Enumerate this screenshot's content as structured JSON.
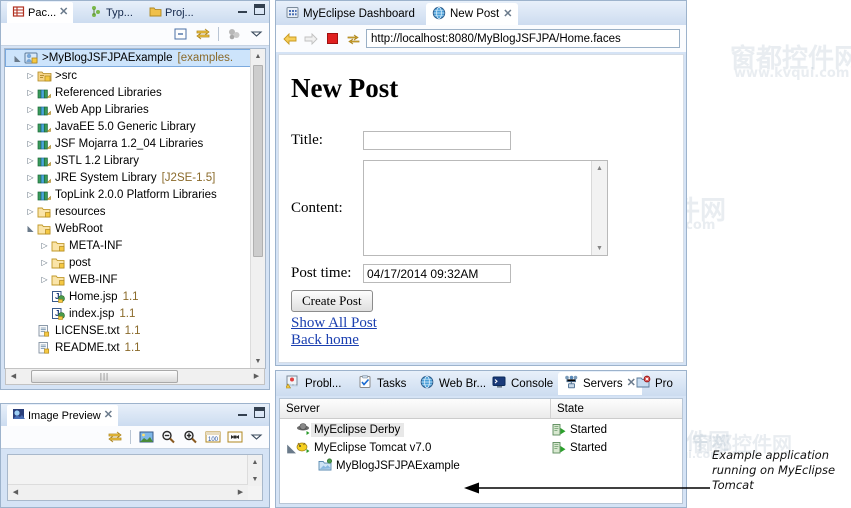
{
  "package_explorer": {
    "tabs": [
      {
        "label": "Pac...",
        "icon": "package-explorer-icon",
        "active": true,
        "closable": true
      },
      {
        "label": "Typ...",
        "icon": "type-hierarchy-icon",
        "active": false,
        "closable": false
      },
      {
        "label": "Proj...",
        "icon": "project-explorer-icon",
        "active": false,
        "closable": false
      }
    ],
    "window_buttons": [
      "minimize",
      "maximize"
    ],
    "toolbar": [
      "collapse-all-icon",
      "link-with-editor-icon",
      "focus-icon",
      "view-menu-icon"
    ],
    "tree": [
      {
        "label": ">MyBlogJSFJPAExample",
        "suffix": "[examples.",
        "icon": "java-project-icon",
        "indent": 0,
        "twisty": "down",
        "selected": true
      },
      {
        "label": ">src",
        "suffix": "",
        "icon": "source-folder-icon",
        "indent": 1,
        "twisty": "right",
        "selected": false
      },
      {
        "label": "Referenced Libraries",
        "suffix": "",
        "icon": "library-icon",
        "indent": 1,
        "twisty": "right",
        "selected": false
      },
      {
        "label": "Web App Libraries",
        "suffix": "",
        "icon": "library-icon",
        "indent": 1,
        "twisty": "right",
        "selected": false
      },
      {
        "label": "JavaEE 5.0 Generic Library",
        "suffix": "",
        "icon": "library-icon",
        "indent": 1,
        "twisty": "right",
        "selected": false
      },
      {
        "label": "JSF Mojarra 1.2_04 Libraries",
        "suffix": "",
        "icon": "library-icon",
        "indent": 1,
        "twisty": "right",
        "selected": false
      },
      {
        "label": "JSTL 1.2 Library",
        "suffix": "",
        "icon": "library-icon",
        "indent": 1,
        "twisty": "right",
        "selected": false
      },
      {
        "label": "JRE System Library",
        "suffix": "[J2SE-1.5]",
        "icon": "library-icon",
        "indent": 1,
        "twisty": "right",
        "selected": false
      },
      {
        "label": "TopLink 2.0.0 Platform Libraries",
        "suffix": "",
        "icon": "library-icon",
        "indent": 1,
        "twisty": "right",
        "selected": false
      },
      {
        "label": "resources",
        "suffix": "",
        "icon": "folder-icon",
        "indent": 1,
        "twisty": "right",
        "selected": false
      },
      {
        "label": "WebRoot",
        "suffix": "",
        "icon": "folder-icon",
        "indent": 1,
        "twisty": "down",
        "selected": false
      },
      {
        "label": "META-INF",
        "suffix": "",
        "icon": "folder-icon",
        "indent": 2,
        "twisty": "right",
        "selected": false
      },
      {
        "label": "post",
        "suffix": "",
        "icon": "folder-icon",
        "indent": 2,
        "twisty": "right",
        "selected": false
      },
      {
        "label": "WEB-INF",
        "suffix": "",
        "icon": "folder-icon",
        "indent": 2,
        "twisty": "right",
        "selected": false
      },
      {
        "label": "Home.jsp",
        "suffix": "1.1",
        "icon": "jsp-file-icon",
        "indent": 2,
        "twisty": "",
        "selected": false
      },
      {
        "label": "index.jsp",
        "suffix": "1.1",
        "icon": "jsp-file-icon",
        "indent": 2,
        "twisty": "",
        "selected": false
      },
      {
        "label": "LICENSE.txt",
        "suffix": "1.1",
        "icon": "text-file-icon",
        "indent": 1,
        "twisty": "",
        "selected": false
      },
      {
        "label": "README.txt",
        "suffix": "1.1",
        "icon": "text-file-icon",
        "indent": 1,
        "twisty": "",
        "selected": false
      }
    ]
  },
  "image_preview": {
    "tab_label": "Image Preview",
    "tab_icon": "image-preview-icon",
    "window_buttons": [
      "minimize",
      "maximize"
    ],
    "toolbar": [
      "link-with-editor-icon",
      "image-icon",
      "zoom-out-icon",
      "zoom-in-icon",
      "zoom-100-icon",
      "fit-image-icon",
      "view-menu-icon"
    ]
  },
  "browser": {
    "tabs": [
      {
        "label": "MyEclipse Dashboard",
        "icon": "dashboard-icon",
        "active": false,
        "closable": false
      },
      {
        "label": "New Post",
        "icon": "globe-icon",
        "active": true,
        "closable": true
      }
    ],
    "nav": {
      "back_icon": "back-arrow-icon",
      "forward_icon": "forward-arrow-icon",
      "stop_icon": "stop-icon",
      "refresh_icon": "refresh-icon"
    },
    "url": "http://localhost:8080/MyBlogJSFJPA/Home.faces"
  },
  "page": {
    "heading": "New Post",
    "fields": [
      {
        "label": "Title:",
        "value": "",
        "type": "text"
      },
      {
        "label": "Content:",
        "value": "",
        "type": "textarea"
      },
      {
        "label": "Post time:",
        "value": "04/17/2014 09:32AM",
        "type": "text"
      }
    ],
    "submit_button": "Create Post",
    "links": [
      "Show All Post",
      "Back home"
    ]
  },
  "bottom_panel": {
    "tabs": [
      {
        "label": "Probl...",
        "icon": "problems-icon",
        "active": false,
        "closable": false
      },
      {
        "label": "Tasks",
        "icon": "tasks-icon",
        "active": false,
        "closable": false
      },
      {
        "label": "Web Br...",
        "icon": "web-browser-icon",
        "active": false,
        "closable": false
      },
      {
        "label": "Console",
        "icon": "console-icon",
        "active": false,
        "closable": false
      },
      {
        "label": "Servers",
        "icon": "servers-icon",
        "active": true,
        "closable": true
      },
      {
        "label": "Pro",
        "icon": "progress-icon",
        "active": false,
        "closable": false
      }
    ],
    "columns": [
      "Server",
      "State"
    ],
    "rows": [
      {
        "server": "MyEclipse Derby",
        "state": "Started",
        "icon": "derby-icon",
        "indent": 1,
        "twisty": "",
        "selected": true
      },
      {
        "server": "MyEclipse Tomcat v7.0",
        "state": "Started",
        "icon": "tomcat-icon",
        "indent": 1,
        "twisty": "down",
        "selected": false
      },
      {
        "server": "MyBlogJSFJPAExample",
        "state": "",
        "icon": "deployed-app-icon",
        "indent": 2,
        "twisty": "",
        "selected": false
      }
    ]
  },
  "annotation": {
    "text": "Example application running on MyEclipse Tomcat",
    "arrow": "left-arrow"
  },
  "watermarks": [
    "窗都控件网",
    "www.kvqui.com"
  ],
  "colors": {
    "accent": "#cde4fb",
    "tab_bar": "#d5e3f5",
    "link": "#1a3fb0",
    "dim_text": "#8a6a2a",
    "started": "#1a7a1a"
  }
}
